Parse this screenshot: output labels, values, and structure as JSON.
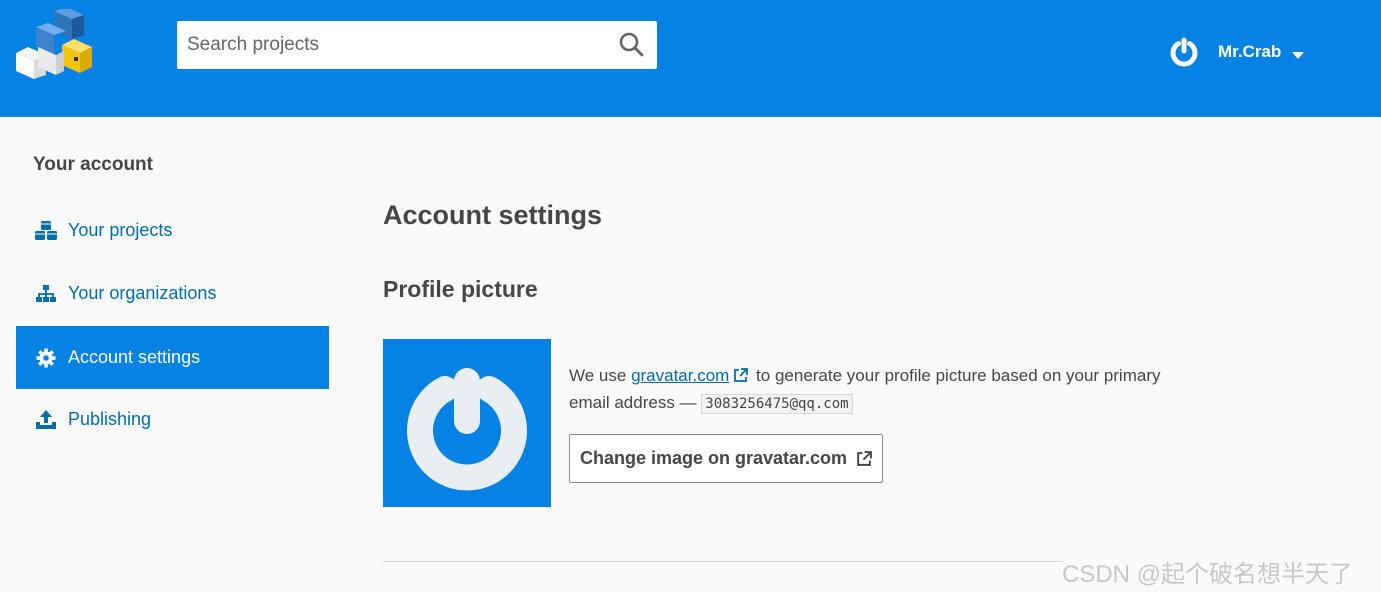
{
  "header": {
    "logo_icon": "pypi-logo-icon",
    "search": {
      "placeholder": "Search projects",
      "value": "",
      "icon": "search-icon"
    },
    "user": {
      "name": "Mr.Crab",
      "avatar_icon": "gravatar-avatar-icon",
      "caret_icon": "caret-down-icon"
    },
    "brand_color": "#0582e4"
  },
  "sidebar": {
    "title": "Your account",
    "items": [
      {
        "label": "Your projects",
        "icon": "cubes-icon",
        "active": false
      },
      {
        "label": "Your organizations",
        "icon": "sitemap-icon",
        "active": false
      },
      {
        "label": "Account settings",
        "icon": "gear-icon",
        "active": true
      },
      {
        "label": "Publishing",
        "icon": "upload-icon",
        "active": false
      }
    ]
  },
  "main": {
    "title": "Account settings",
    "profile": {
      "title": "Profile picture",
      "text_before": "We use ",
      "link_text": "gravatar.com",
      "text_after": " to generate your profile picture based on your primary email address — ",
      "email": "3083256475@qq.com",
      "button_label": "Change image on gravatar.com"
    }
  },
  "watermark": "CSDN @起个破名想半天了"
}
